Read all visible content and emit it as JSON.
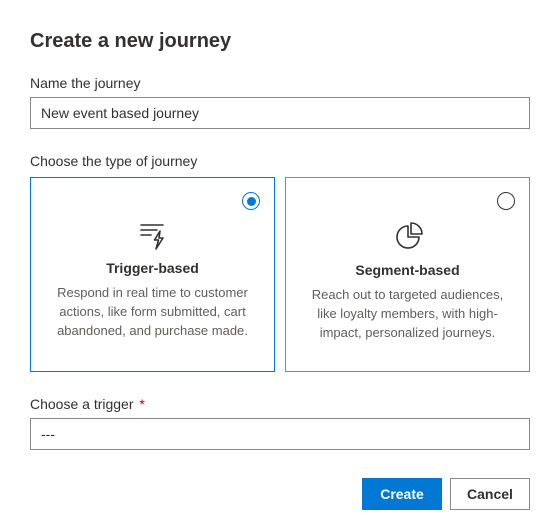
{
  "title": "Create a new journey",
  "nameField": {
    "label": "Name the journey",
    "value": "New event based journey"
  },
  "typeSection": {
    "label": "Choose the type of journey",
    "options": [
      {
        "title": "Trigger-based",
        "description": "Respond in real time to customer actions, like form submitted, cart abandoned, and purchase made.",
        "selected": true
      },
      {
        "title": "Segment-based",
        "description": "Reach out to targeted audiences, like loyalty members, with high-impact, personalized journeys.",
        "selected": false
      }
    ]
  },
  "triggerField": {
    "label": "Choose a trigger",
    "required": "*",
    "value": "---"
  },
  "buttons": {
    "create": "Create",
    "cancel": "Cancel"
  }
}
